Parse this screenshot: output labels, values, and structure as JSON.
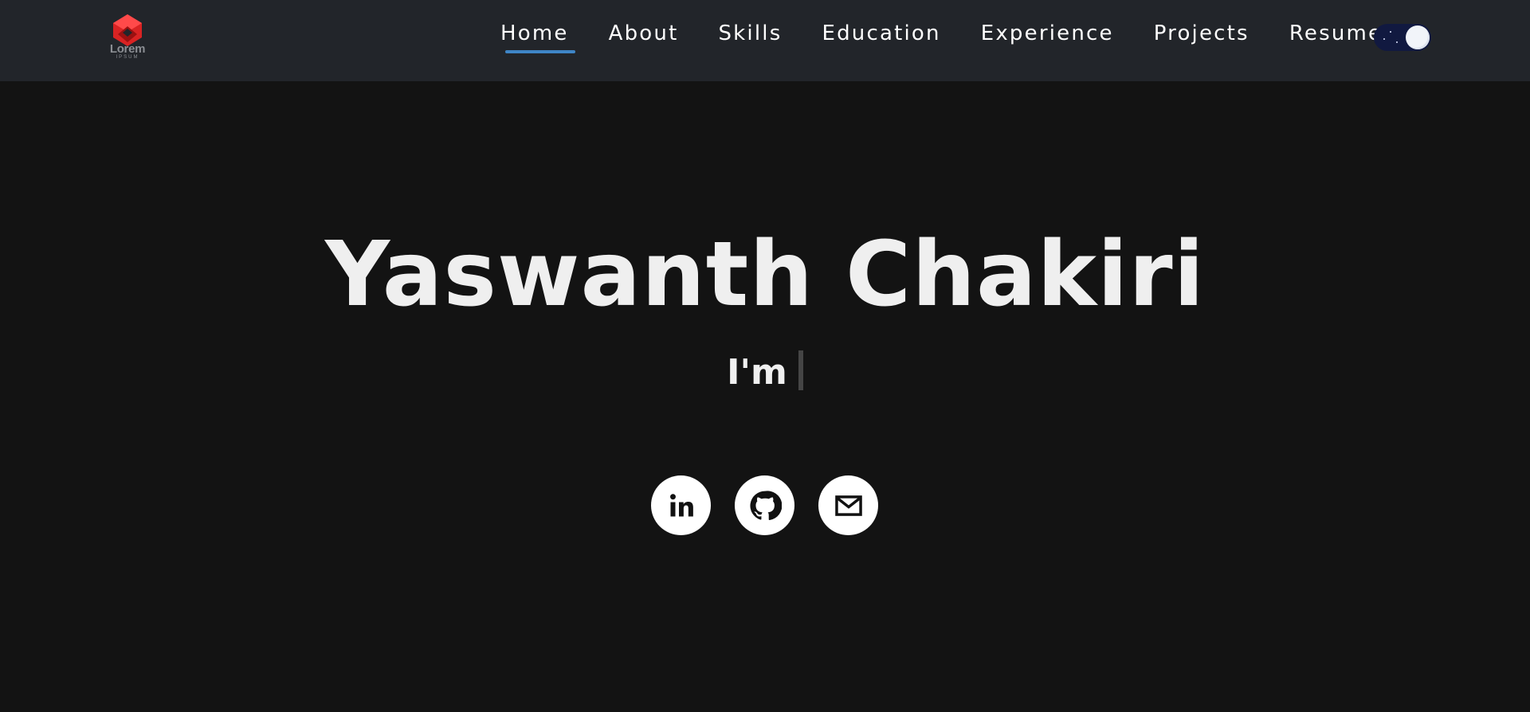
{
  "brand": {
    "logo_text": "Lorem",
    "logo_subtext": "IPSUM",
    "logo_color": "#e02a2a"
  },
  "nav": {
    "items": [
      {
        "label": "Home",
        "active": true
      },
      {
        "label": "About"
      },
      {
        "label": "Skills"
      },
      {
        "label": "Education"
      },
      {
        "label": "Experience"
      },
      {
        "label": "Projects"
      },
      {
        "label": "Resume"
      }
    ],
    "active_underline_color": "#3e85c6"
  },
  "theme_toggle": {
    "icon": "moon-icon",
    "state": "dark"
  },
  "hero": {
    "name": "Yaswanth Chakiri",
    "subtitle": "I'm"
  },
  "socials": [
    {
      "icon": "linkedin-icon"
    },
    {
      "icon": "github-icon"
    },
    {
      "icon": "mail-icon"
    }
  ],
  "colors": {
    "background": "#131313",
    "navbar": "#22252a",
    "text": "#efefef"
  }
}
